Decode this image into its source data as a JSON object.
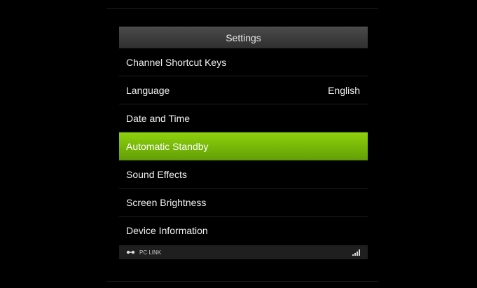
{
  "header": {
    "title": "Settings"
  },
  "menu": {
    "items": [
      {
        "label": "Channel Shortcut Keys",
        "value": ""
      },
      {
        "label": "Language",
        "value": "English"
      },
      {
        "label": "Date and Time",
        "value": ""
      },
      {
        "label": "Automatic Standby",
        "value": ""
      },
      {
        "label": "Sound Effects",
        "value": ""
      },
      {
        "label": "Screen Brightness",
        "value": ""
      },
      {
        "label": "Device Information",
        "value": ""
      }
    ],
    "selected_index": 3
  },
  "status_bar": {
    "connection_label": "PC LINK",
    "connection_icon": "link-icon",
    "signal_icon": "signal-strength-icon"
  },
  "colors": {
    "background": "#000000",
    "header": "#3a3a3a",
    "selected": "#7bbf0a",
    "text": "#f0f0f0"
  }
}
